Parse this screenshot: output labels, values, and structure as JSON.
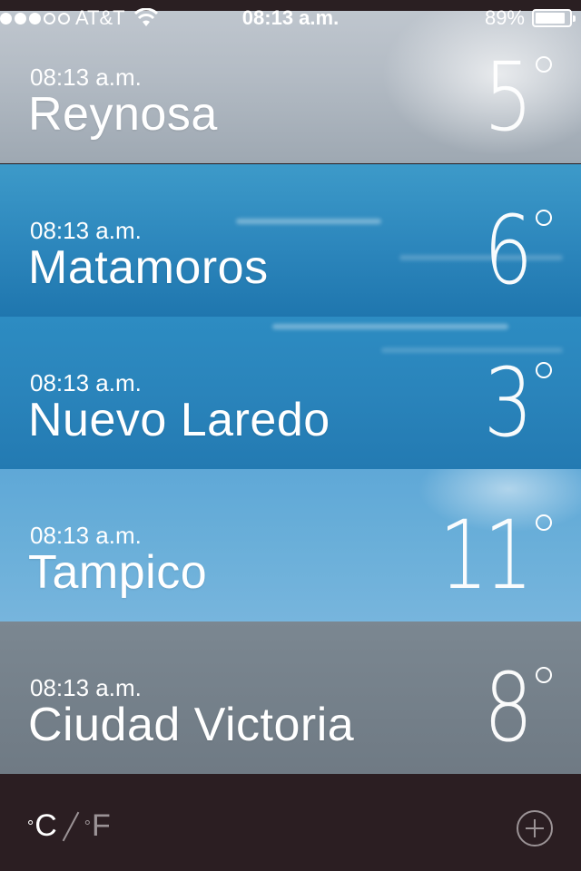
{
  "status_bar": {
    "carrier": "AT&T",
    "time": "08:13 a.m.",
    "battery": "89%",
    "signal_bars": 3,
    "signal_total": 5,
    "battery_level": 0.89
  },
  "cities": [
    {
      "time": "08:13 a.m.",
      "name": "Reynosa",
      "temp": "5"
    },
    {
      "time": "08:13 a.m.",
      "name": "Matamoros",
      "temp": "6"
    },
    {
      "time": "08:13 a.m.",
      "name": "Nuevo Laredo",
      "temp": "3"
    },
    {
      "time": "08:13 a.m.",
      "name": "Tampico",
      "temp": "11"
    },
    {
      "time": "08:13 a.m.",
      "name": "Ciudad Victoria",
      "temp": "8"
    }
  ],
  "footer": {
    "celsius": "C",
    "fahrenheit": "F",
    "degree_symbol": "°"
  }
}
